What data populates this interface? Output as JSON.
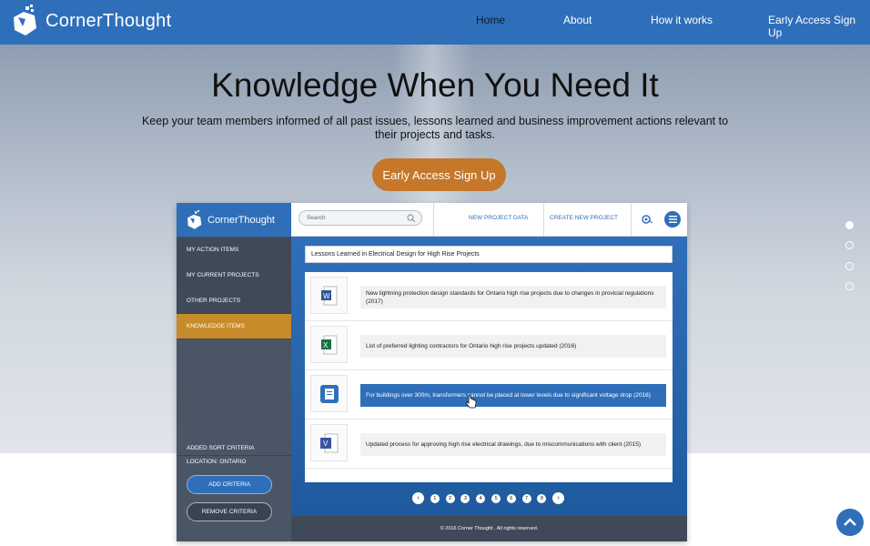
{
  "header": {
    "brand": "CornerThought",
    "nav": [
      "Home",
      "About",
      "How it works",
      "Early Access Sign Up"
    ],
    "active_nav": "Home"
  },
  "hero": {
    "title": "Knowledge When You Need It",
    "subtitle": "Keep your team members informed of all past issues, lessons learned and business improvement actions relevant to their projects and tasks.",
    "cta": "Early Access Sign Up",
    "slide_dots": 4,
    "active_dot": 1
  },
  "app": {
    "brand": "CornerThought",
    "search_placeholder": "Search",
    "top_links": [
      "NEW PROJECT DATA",
      "CREATE NEW PROJECT"
    ],
    "sidebar": {
      "items": [
        "MY ACTION ITEMS",
        "MY CURRENT PROJECTS",
        "OTHER PROJECTS",
        "KNOWLEDGE ITEMS"
      ],
      "active": "KNOWLEDGE ITEMS",
      "sort_label": "ADDED SORT CRITERIA",
      "location": "LOCATION: ONTARIO",
      "add_button": "ADD CRITERIA",
      "remove_button": "REMOVE CRITERIA"
    },
    "list_title": "Lessons Learned in Electrical Design for High Rise Projects",
    "items": [
      {
        "icon": "word-doc-icon",
        "text": "New lightning protection design standards for Ontario high rise projects due to changes in provicial regulations (2017)"
      },
      {
        "icon": "excel-doc-icon",
        "text": "List of preferred lighting contractors for Ontario high rise projects updated (2016)"
      },
      {
        "icon": "document-icon",
        "text": "For buildings over 300m, transformers cannot be placed at lower levels due to significant voltage drop (2016)",
        "selected": true
      },
      {
        "icon": "visio-doc-icon",
        "text": "Updated process for approving high rise electrical drawings, due to miscommunications with client (2015)"
      }
    ],
    "pages": [
      "1",
      "2",
      "3",
      "4",
      "5",
      "6",
      "7",
      "8"
    ],
    "footer": "© 2016 Corner Thought . All rights reserved."
  },
  "colors": {
    "primary": "#2f6fba",
    "cta": "#c5772a",
    "sidebar_active": "#c88b2a",
    "sidebar": "#4a5566"
  }
}
